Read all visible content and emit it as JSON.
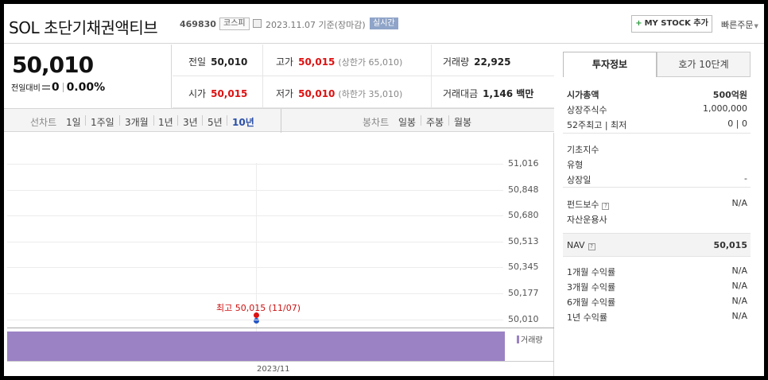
{
  "header": {
    "title": "SOL 초단기채권액티브",
    "code": "469830",
    "market": "코스피",
    "date": "2023.11.07 기준(장마감)",
    "realtime": "실시간",
    "mystock_plus": "+",
    "mystock": "MY STOCK 추가",
    "quick_order": "빠른주문"
  },
  "price": {
    "current": "50,010",
    "change_label": "전일대비",
    "change_value": "0",
    "change_pct": "0.00%"
  },
  "quotes": {
    "prev_close_label": "전일",
    "prev_close": "50,010",
    "high_label": "고가",
    "high": "50,015",
    "upper_limit": "(상한가 65,010)",
    "volume_label": "거래량",
    "volume": "22,925",
    "open_label": "시가",
    "open": "50,015",
    "low_label": "저가",
    "low": "50,010",
    "lower_limit": "(하한가 35,010)",
    "amount_label": "거래대금",
    "amount": "1,146 백만"
  },
  "chart_tabs": {
    "line_label": "선차트",
    "line_periods": [
      "1일",
      "1주일",
      "3개월",
      "1년",
      "3년",
      "5년",
      "10년"
    ],
    "active_period": "10년",
    "candle_label": "봉차트",
    "candle_periods": [
      "일봉",
      "주봉",
      "월봉"
    ]
  },
  "chart_data": {
    "type": "line",
    "y_ticks": [
      "51,016",
      "50,848",
      "50,680",
      "50,513",
      "50,345",
      "50,177",
      "50,010"
    ],
    "ylim": [
      50010,
      51016
    ],
    "x_ticks": [
      "2023/11"
    ],
    "high_annotation": "최고 50,015 (11/07)",
    "points": [
      {
        "x": "2023-11-07",
        "high": 50015,
        "low": 50010
      }
    ],
    "volume_legend": "거래량",
    "colors": {
      "high": "#dd1111",
      "low": "#2456c7",
      "volume": "#9b82c4"
    }
  },
  "right_panel": {
    "tabs": [
      "투자정보",
      "호가 10단계"
    ],
    "rows1": [
      {
        "k": "시가총액",
        "v": "500억원"
      },
      {
        "k": "상장주식수",
        "v": "1,000,000"
      },
      {
        "k": "52주최고 | 최저",
        "v": "0 | 0"
      }
    ],
    "rows2": [
      {
        "k": "기초지수",
        "v": ""
      },
      {
        "k": "유형",
        "v": ""
      },
      {
        "k": "상장일",
        "v": "-"
      }
    ],
    "rows3": [
      {
        "k": "펀드보수",
        "v": "N/A"
      },
      {
        "k": "자산운용사",
        "v": ""
      }
    ],
    "nav": {
      "k": "NAV",
      "v": "50,015"
    },
    "rows4": [
      {
        "k": "1개월 수익률",
        "v": "N/A"
      },
      {
        "k": "3개월 수익률",
        "v": "N/A"
      },
      {
        "k": "6개월 수익률",
        "v": "N/A"
      },
      {
        "k": "1년 수익률",
        "v": "N/A"
      }
    ],
    "info_icon": "?"
  }
}
